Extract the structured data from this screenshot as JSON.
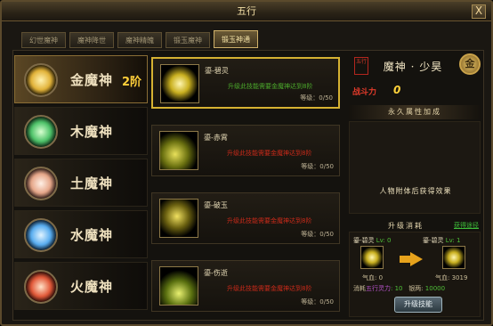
{
  "window": {
    "title": "五行",
    "close_label": "X"
  },
  "tabs": [
    {
      "label": "幻世魔神",
      "active": false
    },
    {
      "label": "魔神降世",
      "active": false
    },
    {
      "label": "魔神精魄",
      "active": false
    },
    {
      "label": "锻玉魔神",
      "active": false
    },
    {
      "label": "锻玉神通",
      "active": true
    }
  ],
  "deities": [
    {
      "name": "金魔神",
      "level": "2阶",
      "active": true,
      "color": "#e2b33a"
    },
    {
      "name": "木魔神",
      "level": "",
      "active": false,
      "color": "#4fc36a"
    },
    {
      "name": "土魔神",
      "level": "",
      "active": false,
      "color": "#e6a78a"
    },
    {
      "name": "水魔神",
      "level": "",
      "active": false,
      "color": "#5aaef0"
    },
    {
      "name": "火魔神",
      "level": "",
      "active": false,
      "color": "#e25a3a"
    }
  ],
  "skills": [
    {
      "name": "鎏-碧灵",
      "requirement": "升级此技能需要金魔神达到8阶",
      "level": "等级：0/50",
      "selected": true
    },
    {
      "name": "鎏-赤霄",
      "requirement": "升级此技能需要金魔神达到8阶",
      "level": "等级：0/50",
      "selected": false
    },
    {
      "name": "鎏-破玉",
      "requirement": "升级此技能需要金魔神达到8阶",
      "level": "等级：0/50",
      "selected": false
    },
    {
      "name": "鎏-伤逝",
      "requirement": "升级此技能需要金魔神达到8阶",
      "level": "等级：0/50",
      "selected": false
    }
  ],
  "hero": {
    "seal_text": "五行",
    "title": "魔神 · 少昊",
    "emblem": "金",
    "power_label": "战斗力",
    "power_value": "0"
  },
  "attributes": {
    "header": "永久属性加成",
    "text": "人物附体后获得效果"
  },
  "upgrade": {
    "header": "升级消耗",
    "link": "获得途径",
    "from_name": "鎏-碧灵",
    "from_lv": "Lv: 0",
    "to_name": "鎏-碧灵",
    "to_lv": "Lv: 1",
    "from_stat": "气血: 0",
    "to_stat": "气血: 3019",
    "cost_prefix": "消耗",
    "cost_resource": "五行灵力",
    "cost_value": ": 10",
    "silver_label": "银两:",
    "silver_value": "10000",
    "button": "升级技能"
  }
}
